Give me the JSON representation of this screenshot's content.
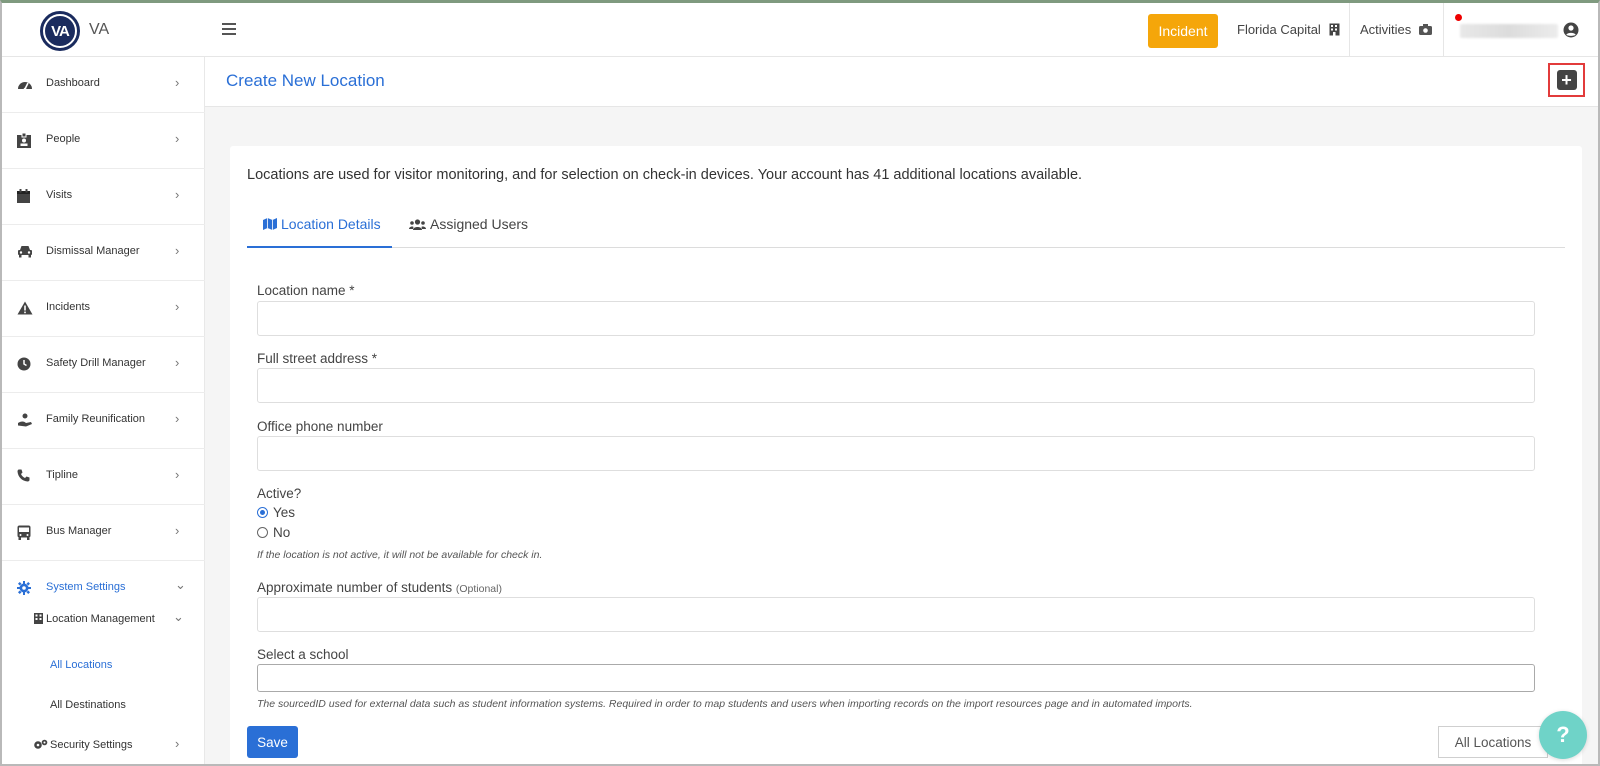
{
  "brand": {
    "logo_text": "VA",
    "name": "VA"
  },
  "topbar": {
    "incident_label": "Incident",
    "location_label": "Florida Capital",
    "activities_label": "Activities"
  },
  "sidebar": {
    "items": [
      {
        "label": "Dashboard",
        "icon": "dashboard-icon"
      },
      {
        "label": "People",
        "icon": "id-badge-icon"
      },
      {
        "label": "Visits",
        "icon": "calendar-icon"
      },
      {
        "label": "Dismissal Manager",
        "icon": "car-icon"
      },
      {
        "label": "Incidents",
        "icon": "warning-icon"
      },
      {
        "label": "Safety Drill Manager",
        "icon": "clock-icon"
      },
      {
        "label": "Family Reunification",
        "icon": "hand-heart-icon"
      },
      {
        "label": "Tipline",
        "icon": "phone-icon"
      },
      {
        "label": "Bus Manager",
        "icon": "bus-icon"
      },
      {
        "label": "System Settings",
        "icon": "gear-icon"
      }
    ],
    "location_management": "Location Management",
    "all_locations": "All Locations",
    "all_destinations": "All Destinations",
    "security_settings": "Security Settings"
  },
  "page": {
    "title": "Create New Location",
    "intro": "Locations are used for visitor monitoring, and for selection on check-in devices. Your account has 41 additional locations available.",
    "tabs": [
      "Location Details",
      "Assigned Users"
    ]
  },
  "form": {
    "location_name_label": "Location name *",
    "location_name_value": "",
    "address_label": "Full street address *",
    "address_value": "",
    "phone_label": "Office phone number",
    "phone_value": "",
    "active_label": "Active?",
    "active_yes": "Yes",
    "active_no": "No",
    "active_selected": "Yes",
    "active_hint": "If the location is not active, it will not be available for check in.",
    "students_label": "Approximate number of students",
    "students_optional": "(Optional)",
    "students_value": "",
    "school_label": "Select a school",
    "school_value": "",
    "school_hint": "The sourcedID used for external data such as student information systems. Required in order to map students and users when importing records on the import resources page and in automated imports.",
    "save_label": "Save",
    "all_locations_label": "All Locations"
  },
  "help": {
    "label": "?"
  },
  "colors": {
    "accent": "#2a6fd6",
    "incident": "#f5a60a",
    "highlight_border": "#e23b3b",
    "help": "#6fd3c8"
  }
}
